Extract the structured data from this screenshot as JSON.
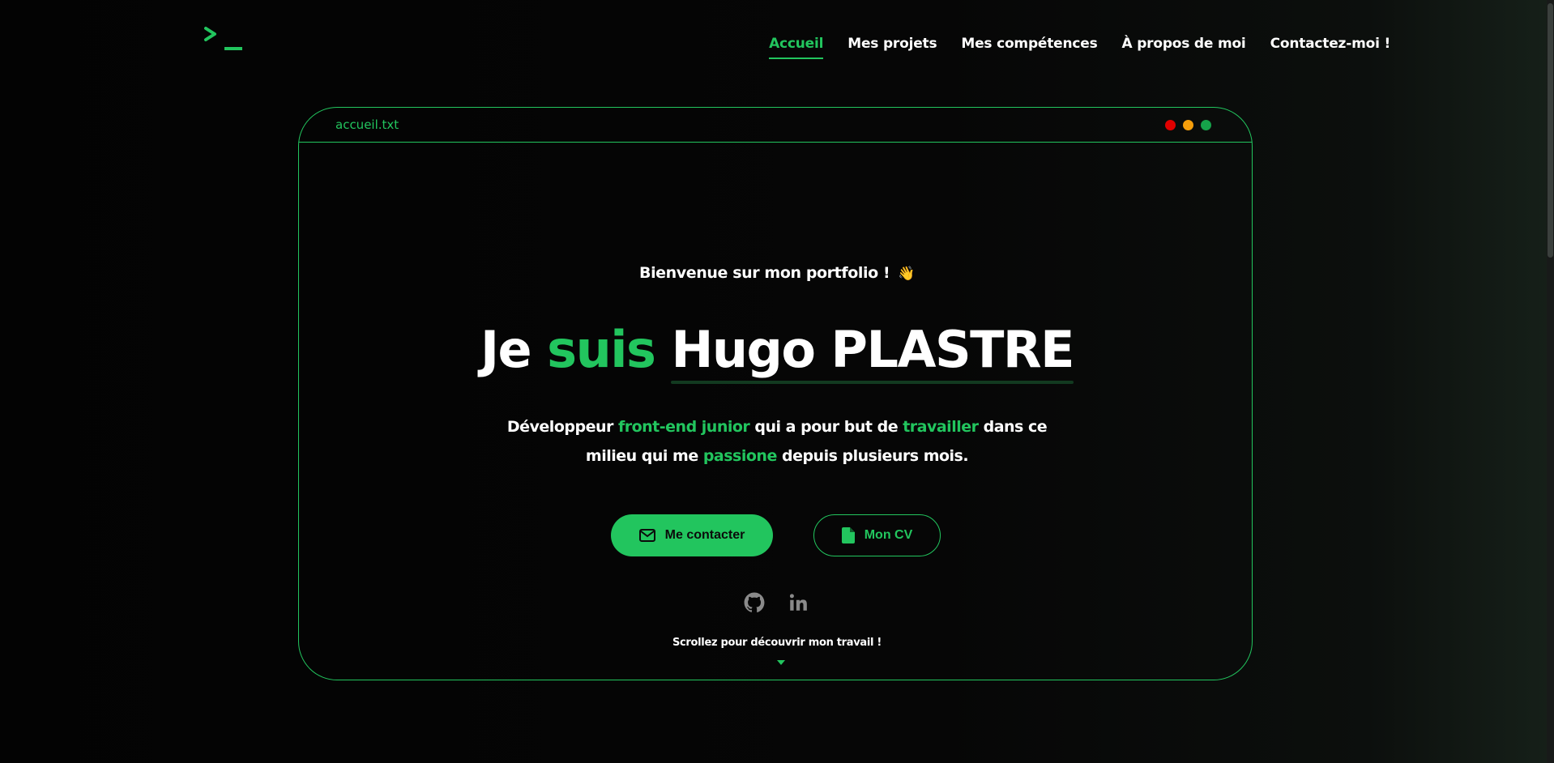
{
  "header": {
    "logo_icon": "terminal-prompt-icon",
    "nav": [
      {
        "label": "Accueil",
        "active": true
      },
      {
        "label": "Mes projets",
        "active": false
      },
      {
        "label": "Mes compétences",
        "active": false
      },
      {
        "label": "À propos de moi",
        "active": false
      },
      {
        "label": "Contactez-moi !",
        "active": false
      }
    ]
  },
  "window": {
    "filename": "accueil.txt",
    "controls": [
      "close-dot",
      "minimize-dot",
      "maximize-dot"
    ]
  },
  "hero": {
    "welcome": "Bienvenue sur mon portfolio !",
    "wave_emoji": "👋",
    "headline": {
      "word1": "Je",
      "word2": "suis",
      "name": "Hugo PLASTRE"
    },
    "tagline": {
      "p1": "Développeur ",
      "h1": "front-end junior",
      "p2": " qui a pour but de ",
      "h2": "travailler",
      "p3": " dans ce milieu qui me ",
      "h3": "passione",
      "p4": " depuis plusieurs mois."
    },
    "buttons": {
      "contact": "Me contacter",
      "cv": "Mon CV"
    },
    "socials": [
      "github-icon",
      "linkedin-icon"
    ],
    "scroll_hint": "Scrollez pour découvrir mon travail !"
  },
  "colors": {
    "accent": "#22c55e",
    "background": "#050505",
    "text": "#ffffff"
  }
}
